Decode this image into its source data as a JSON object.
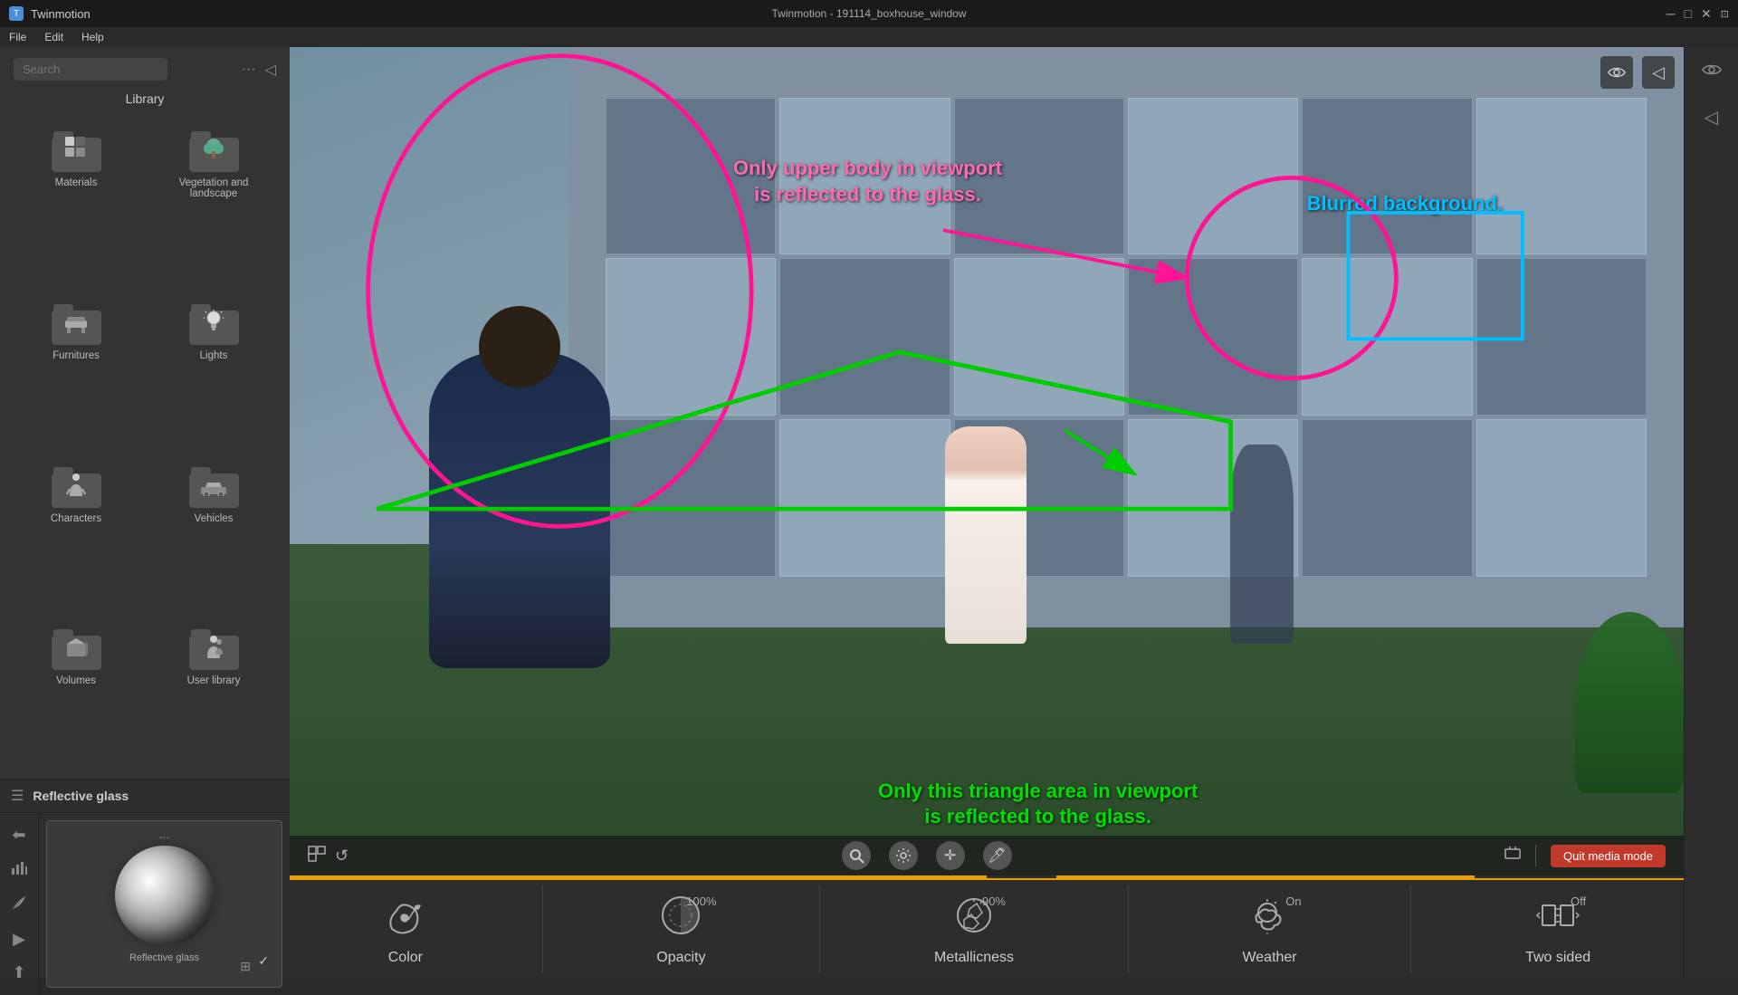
{
  "titlebar": {
    "app_name": "Twinmotion",
    "title": "Twinmotion - 191114_boxhouse_window",
    "minimize": "─",
    "maximize": "□",
    "close": "✕",
    "corner_icon": "⊡"
  },
  "menubar": {
    "file": "File",
    "edit": "Edit",
    "help": "Help"
  },
  "sidebar": {
    "search_placeholder": "Search",
    "library_label": "Library",
    "items": [
      {
        "id": "materials",
        "label": "Materials",
        "icon": "🎨"
      },
      {
        "id": "vegetation",
        "label": "Vegetation and landscape",
        "icon": "🌿"
      },
      {
        "id": "furnitures",
        "label": "Furnitures",
        "icon": "🛋️"
      },
      {
        "id": "lights",
        "label": "Lights",
        "icon": "💡"
      },
      {
        "id": "characters",
        "label": "Characters",
        "icon": "🧍"
      },
      {
        "id": "vehicles",
        "label": "Vehicles",
        "icon": "🚗"
      },
      {
        "id": "volumes",
        "label": "Volumes",
        "icon": "📦"
      },
      {
        "id": "user-library",
        "label": "User library",
        "icon": "👤"
      }
    ]
  },
  "bottom_panel": {
    "title": "Reflective glass",
    "material_name": "Reflective glass",
    "more_dots": "...",
    "panel_icons": [
      "⬅",
      "📊",
      "✏️",
      "▶",
      "⬆"
    ]
  },
  "viewport": {
    "annotation_upper_body": "Only upper body in viewport\nis reflected to the glass.",
    "annotation_blurred": "Blurred background.",
    "annotation_triangle": "Only this triangle area in viewport\nis reflected to the glass.",
    "toolbar_tools": [
      "🔍",
      "⚙",
      "✛",
      "🖊"
    ],
    "quit_media": "Quit media mode",
    "top_icons": [
      "👁",
      "◁"
    ]
  },
  "properties": [
    {
      "id": "color",
      "label": "Color",
      "value": "",
      "icon": "color"
    },
    {
      "id": "opacity",
      "label": "Opacity",
      "value": "100%",
      "icon": "opacity"
    },
    {
      "id": "metallicness",
      "label": "Metallicness",
      "value": "90%",
      "icon": "metal"
    },
    {
      "id": "weather",
      "label": "Weather",
      "value": "On",
      "icon": "weather"
    },
    {
      "id": "two-sided",
      "label": "Two sided",
      "value": "Off",
      "icon": "twosided"
    }
  ],
  "progress": [
    {
      "color": "#e8a000",
      "width": "50%"
    },
    {
      "color": "#e8a000",
      "width": "30%"
    }
  ],
  "colors": {
    "accent_orange": "#e8a000",
    "pink": "#ff1493",
    "cyan": "#00bfff",
    "green": "#00e000",
    "sidebar_bg": "#333",
    "panel_bg": "#2d2d2d",
    "dark_bg": "#1a1a1a"
  }
}
